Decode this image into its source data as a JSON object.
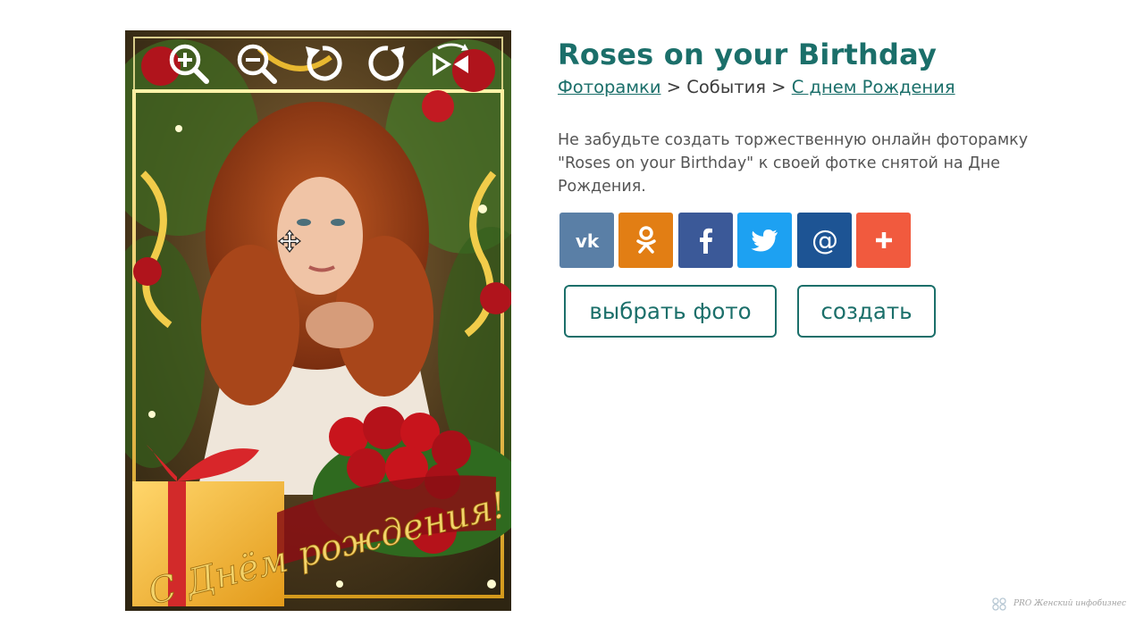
{
  "photo_frame": {
    "toolbar": {
      "zoom_in_icon": "zoom-in-icon",
      "zoom_out_icon": "zoom-out-icon",
      "rotate_left_icon": "rotate-left-icon",
      "rotate_right_icon": "rotate-right-icon",
      "flip_icon": "flip-horizontal-icon"
    },
    "cursor_icon": "move-cursor-icon",
    "frame_caption": "С Днём рождения!"
  },
  "page": {
    "title": "Roses on your Birthday",
    "breadcrumb": {
      "item1": "Фоторамки",
      "sep1": " > ",
      "item2": "События",
      "sep2": " > ",
      "item3": "С днем Рождения"
    },
    "description": "Не забудьте создать торжественную онлайн фоторамку \"Roses on your Birthday\" к своей фотке снятой на Дне Рождения."
  },
  "share": {
    "buttons": [
      {
        "icon": "vk-icon",
        "color": "#5a7fa6"
      },
      {
        "icon": "odnoklassniki-icon",
        "color": "#e27e14"
      },
      {
        "icon": "facebook-icon",
        "color": "#3b5998"
      },
      {
        "icon": "twitter-icon",
        "color": "#1da1f2"
      },
      {
        "icon": "mail-icon",
        "color": "#1d5494"
      },
      {
        "icon": "plus-icon",
        "color": "#f15a3e"
      }
    ]
  },
  "actions": {
    "choose_photo": "выбрать фото",
    "create": "создать"
  },
  "watermark": {
    "text": "PRO Женский инфобизнес"
  },
  "colors": {
    "accent": "#1b6f6a",
    "text": "#555555"
  }
}
